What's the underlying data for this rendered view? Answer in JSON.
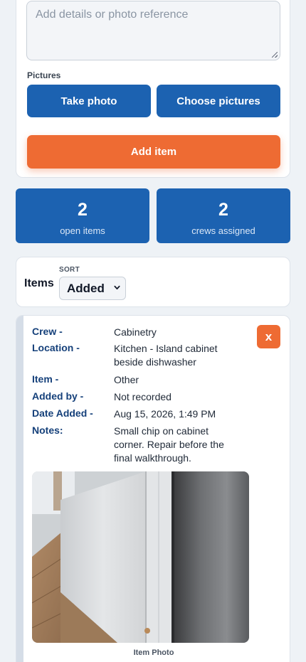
{
  "form": {
    "notes_placeholder": "Add details or photo reference",
    "pictures_label": "Pictures",
    "take_photo_label": "Take photo",
    "choose_pictures_label": "Choose pictures",
    "add_item_label": "Add item"
  },
  "stats": [
    {
      "value": "2",
      "label": "open items"
    },
    {
      "value": "2",
      "label": "crews assigned"
    }
  ],
  "sort": {
    "items_label": "Items",
    "sort_label": "SORT",
    "selected": "Added"
  },
  "item": {
    "close_label": "x",
    "fields": [
      {
        "key": "Crew -",
        "value": "Cabinetry"
      },
      {
        "key": "Location -",
        "value": "Kitchen - Island cabinet beside dishwasher"
      },
      {
        "key": "Item -",
        "value": "Other"
      },
      {
        "key": "Added by -",
        "value": "Not recorded"
      },
      {
        "key": "Date Added -",
        "value": "Aug 15, 2026, 1:49 PM"
      },
      {
        "key": "Notes:",
        "value": "Small chip on cabinet corner. Repair before the final walkthrough."
      }
    ],
    "photo_caption": "Item Photo"
  },
  "colors": {
    "primary": "#1c62b1",
    "accent": "#ee6b33",
    "label_blue": "#15407a",
    "background": "#eef2f6"
  }
}
